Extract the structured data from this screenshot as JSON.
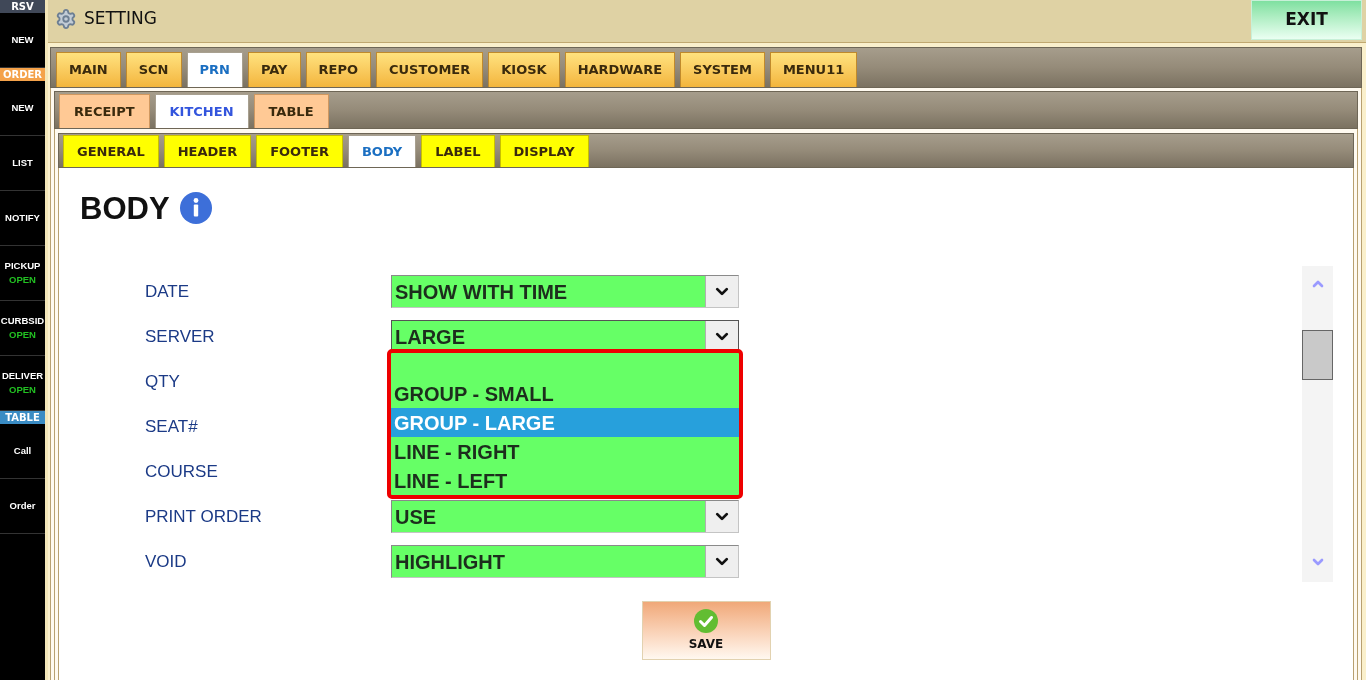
{
  "sidebar": [
    {
      "kind": "header",
      "label": "RSV",
      "color": "#404858"
    },
    {
      "kind": "button",
      "label": "NEW"
    },
    {
      "kind": "header",
      "label": "ORDER",
      "color": "#f4a24a"
    },
    {
      "kind": "button",
      "label": "NEW"
    },
    {
      "kind": "button",
      "label": "LIST"
    },
    {
      "kind": "button",
      "label": "NOTIFY"
    },
    {
      "kind": "button",
      "label": "PICKUP",
      "status": "OPEN"
    },
    {
      "kind": "button",
      "label": "CURBSID",
      "status": "OPEN"
    },
    {
      "kind": "button",
      "label": "DELIVER",
      "status": "OPEN"
    },
    {
      "kind": "header",
      "label": "TABLE",
      "color": "#3a8cc4"
    },
    {
      "kind": "button",
      "label": "Call"
    },
    {
      "kind": "button",
      "label": "Order"
    }
  ],
  "window": {
    "title": "SETTING",
    "exit_button": "EXIT"
  },
  "main_tabs": [
    {
      "label": "MAIN",
      "selected": false
    },
    {
      "label": "SCN",
      "selected": false
    },
    {
      "label": "PRN",
      "selected": true
    },
    {
      "label": "PAY",
      "selected": false
    },
    {
      "label": "REPO",
      "selected": false
    },
    {
      "label": "CUSTOMER",
      "selected": false
    },
    {
      "label": "KIOSK",
      "selected": false
    },
    {
      "label": "HARDWARE",
      "selected": false
    },
    {
      "label": "SYSTEM",
      "selected": false
    },
    {
      "label": "MENU11",
      "selected": false
    }
  ],
  "printer_tabs": [
    {
      "label": "RECEIPT",
      "selected": false
    },
    {
      "label": "KITCHEN",
      "selected": true
    },
    {
      "label": "TABLE",
      "selected": false
    }
  ],
  "section_tabs": [
    {
      "label": "GENERAL",
      "selected": false
    },
    {
      "label": "HEADER",
      "selected": false
    },
    {
      "label": "FOOTER",
      "selected": false
    },
    {
      "label": "BODY",
      "selected": true
    },
    {
      "label": "LABEL",
      "selected": false
    },
    {
      "label": "DISPLAY",
      "selected": false
    }
  ],
  "panel": {
    "title": "BODY",
    "fields": [
      {
        "label": "DATE",
        "value": "SHOW WITH TIME",
        "expanded": false
      },
      {
        "label": "SERVER",
        "value": "LARGE",
        "expanded": true,
        "options": [
          {
            "label": "GROUP - SMALL",
            "selected": false
          },
          {
            "label": "GROUP - LARGE",
            "selected": true
          },
          {
            "label": "LINE - RIGHT",
            "selected": false
          },
          {
            "label": "LINE - LEFT",
            "selected": false
          }
        ]
      },
      {
        "label": "QTY"
      },
      {
        "label": "SEAT#"
      },
      {
        "label": "COURSE"
      },
      {
        "label": "PRINT ORDER",
        "value": "USE",
        "expanded": false
      },
      {
        "label": "VOID",
        "value": "HIGHLIGHT",
        "expanded": false
      }
    ],
    "save_button": "SAVE"
  }
}
